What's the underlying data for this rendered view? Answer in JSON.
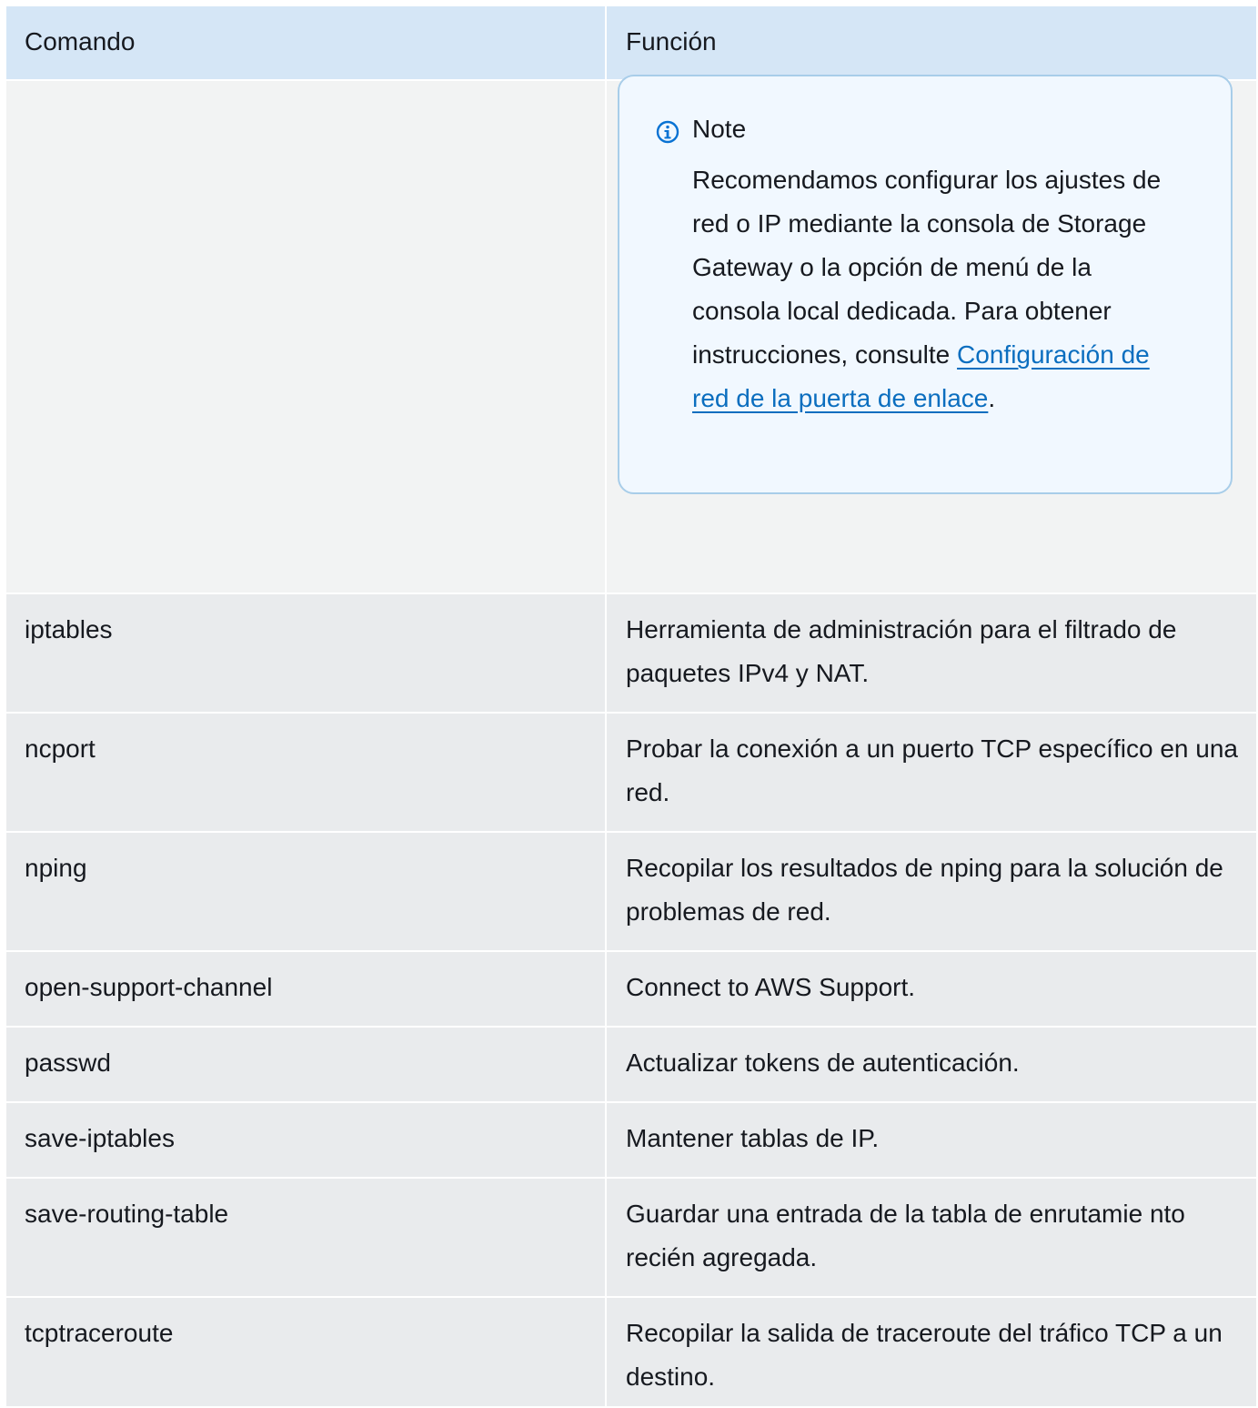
{
  "table": {
    "headers": {
      "command": "Comando",
      "function": "Función"
    },
    "note": {
      "title": "Note",
      "text": "Recomendamos configurar los ajustes de red o IP mediante la consola de Storage Gateway o la opción de menú de la consola local dedicada. Para obtener instrucciones, consulte ",
      "link": "Configuración de red de la puerta de enlace",
      "after": "."
    },
    "rows": [
      {
        "command": "iptables",
        "function": "Herramienta de administración para el filtrado de paquetes IPv4 y NAT."
      },
      {
        "command": "ncport",
        "function": "Probar la conexión a un puerto TCP específico en una red."
      },
      {
        "command": "nping",
        "function": "Recopilar los resultados de nping para la solución de problemas de red."
      },
      {
        "command": "open-support-channel",
        "function": "Connect to AWS Support."
      },
      {
        "command": "passwd",
        "function": "Actualizar tokens de autenticación."
      },
      {
        "command": "save-iptables",
        "function": "Mantener tablas de IP."
      },
      {
        "command": "save-routing-table",
        "function": "Guardar una entrada de la tabla de enrutamie nto recién agregada."
      },
      {
        "command": "tcptraceroute",
        "function": "Recopilar la salida de traceroute del tráfico TCP a un destino."
      }
    ]
  },
  "colors": {
    "header_bg": "#d5e6f6",
    "row_bg": "#e9ebed",
    "note_bg": "#f1f8ff",
    "note_border": "#a8cde9",
    "link": "#0b6ebf"
  },
  "icons": {
    "note": "info-circle-icon"
  }
}
